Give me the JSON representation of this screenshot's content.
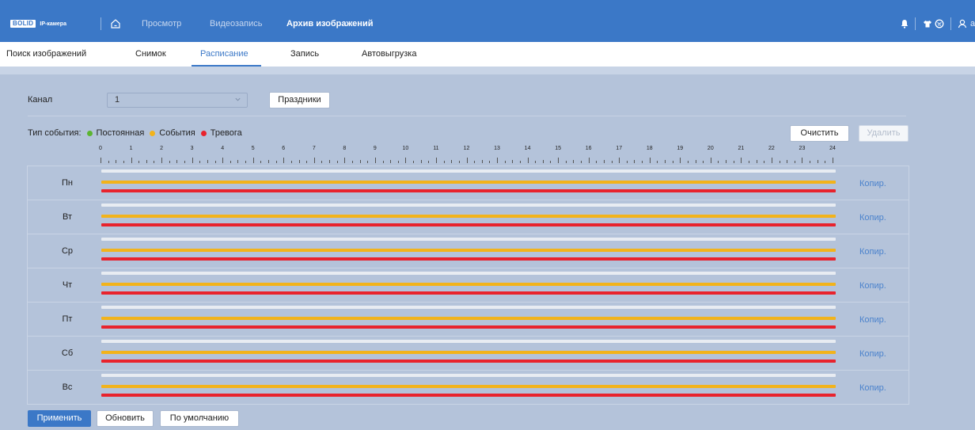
{
  "header": {
    "logo_brand": "BOLID",
    "logo_product": "IP-камера",
    "nav": [
      "Просмотр",
      "Видеозапись",
      "Архив изображений"
    ],
    "active_nav": "Архив изображений",
    "user": "admin"
  },
  "subnav": {
    "items": [
      "Поиск изображений",
      "Снимок",
      "Расписание",
      "Запись",
      "Автовыгрузка"
    ],
    "active": "Расписание"
  },
  "form": {
    "channel_label": "Канал",
    "channel_value": "1",
    "holidays_button": "Праздники"
  },
  "events": {
    "label": "Тип события:",
    "types": [
      {
        "label": "Постоянная",
        "color": "#5cb531"
      },
      {
        "label": "События",
        "color": "#f2b31b"
      },
      {
        "label": "Тревога",
        "color": "#e8232d"
      }
    ],
    "clear_button": "Очистить",
    "delete_button": "Удалить"
  },
  "ruler": {
    "hours": [
      "0",
      "1",
      "2",
      "3",
      "4",
      "5",
      "6",
      "7",
      "8",
      "9",
      "10",
      "11",
      "12",
      "13",
      "14",
      "15",
      "16",
      "17",
      "18",
      "19",
      "20",
      "21",
      "22",
      "23",
      "24"
    ]
  },
  "schedule": {
    "days": [
      "Пн",
      "Вт",
      "Ср",
      "Чт",
      "Пт",
      "Сб",
      "Вс"
    ],
    "copy_label": "Копир.",
    "bar_colors": [
      "#e8ecf2",
      "#f2b31b",
      "#e8232d"
    ]
  },
  "footer": {
    "apply": "Применить",
    "refresh": "Обновить",
    "default": "По умолчанию"
  }
}
